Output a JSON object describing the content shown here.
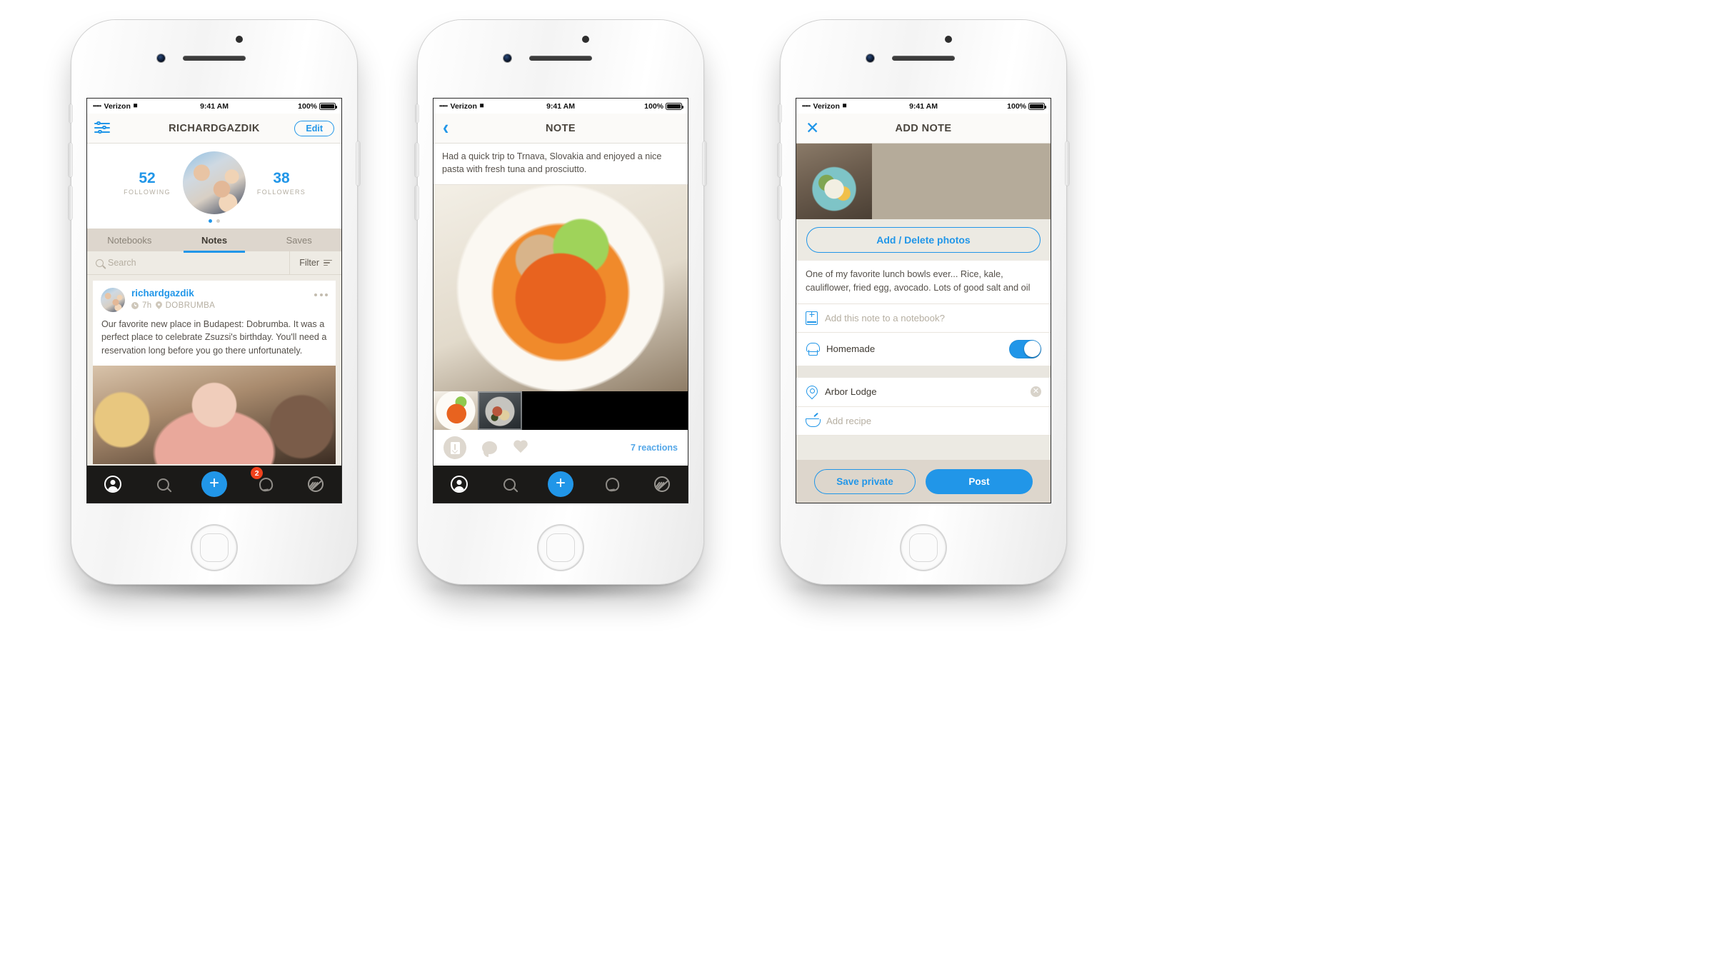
{
  "status_bar": {
    "carrier_dots": "•••••",
    "carrier": "Verizon",
    "wifi_icon": "wifi-icon",
    "time": "9:41 AM",
    "battery_percent": "100%"
  },
  "phone1": {
    "nav": {
      "settings_icon": "sliders-icon",
      "title": "RICHARDGAZDIK",
      "edit_label": "Edit"
    },
    "profile": {
      "following_count": "52",
      "following_label": "FOLLOWING",
      "followers_count": "38",
      "followers_label": "FOLLOWERS",
      "avatar": "profile-avatar",
      "page_dots": 2,
      "active_dot": 0
    },
    "tabs": [
      {
        "label": "Notebooks",
        "active": false
      },
      {
        "label": "Notes",
        "active": true
      },
      {
        "label": "Saves",
        "active": false
      }
    ],
    "search": {
      "placeholder": "Search",
      "icon": "search-icon"
    },
    "filter": {
      "label": "Filter",
      "icon": "filter-icon"
    },
    "post": {
      "username": "richardgazdik",
      "time_ago": "7h",
      "location": "DOBRUMBA",
      "menu_icon": "more-options-icon",
      "body": "Our favorite new place in Budapest: Dobrumba. It was a perfect place to celebrate Zsuzsi's birthday. You'll need a reservation long before you go there unfortunately.",
      "photo": "restaurant-photo"
    }
  },
  "phone2": {
    "nav": {
      "back_icon": "back-chevron-icon",
      "title": "NOTE"
    },
    "note_text": "Had a quick trip to Trnava, Slovakia and enjoyed a nice pasta with fresh tuna and prosciutto.",
    "hero_photo": "pasta-photo",
    "thumbnails": [
      {
        "name": "pasta-thumbnail",
        "selected": false
      },
      {
        "name": "plate-thumbnail",
        "selected": true
      }
    ],
    "actions": {
      "save_icon": "save-icon",
      "comment_icon": "comment-icon",
      "like_icon": "heart-icon",
      "reactions_label": "7 reactions"
    }
  },
  "phone3": {
    "nav": {
      "close_icon": "close-icon",
      "title": "ADD NOTE"
    },
    "photo": "lunch-bowl-photo",
    "add_photos_label": "Add / Delete photos",
    "note_body": "One of my favorite lunch bowls ever... Rice, kale, cauliflower, fried egg, avocado. Lots of good salt and oil",
    "fields": [
      {
        "icon": "add-notebook-icon",
        "label": "Add this note to a notebook?",
        "placeholder": true
      },
      {
        "icon": "chef-hat-icon",
        "label": "Homemade",
        "placeholder": false,
        "toggle": true,
        "toggle_on": true
      },
      {
        "icon": "location-pin-icon",
        "label": "Arbor Lodge",
        "placeholder": false,
        "clear": true
      },
      {
        "icon": "recipe-bowl-icon",
        "label": "Add recipe",
        "placeholder": true
      }
    ],
    "save_private_label": "Save private",
    "post_label": "Post"
  },
  "tab_bar": {
    "items": [
      {
        "name": "profile",
        "icon": "person-icon",
        "active": true
      },
      {
        "name": "search",
        "icon": "search-icon",
        "active": false
      },
      {
        "name": "add",
        "icon": "plus-icon",
        "active": false
      },
      {
        "name": "notifications",
        "icon": "bell-icon",
        "active": false,
        "badge": "2"
      },
      {
        "name": "discover",
        "icon": "fork-plate-icon",
        "active": false
      }
    ]
  },
  "colors": {
    "accent_blue": "#2196e8",
    "badge_red": "#f0411c",
    "tabbar_dark": "#1b1a18",
    "tab_strip": "#ddd6cd",
    "page_bg": "#eeebe4"
  }
}
